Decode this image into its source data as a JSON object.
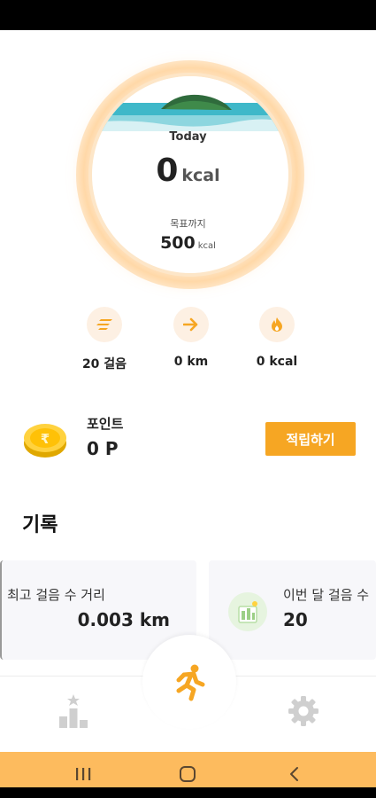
{
  "hero": {
    "today_label": "Today",
    "calories": "0",
    "calories_unit": "kcal",
    "goal_label": "목표까지",
    "goal_value": "500",
    "goal_unit": "kcal"
  },
  "stats": [
    {
      "icon": "steps-icon",
      "label": "20 걸음"
    },
    {
      "icon": "arrow-right-icon",
      "label": "0 km"
    },
    {
      "icon": "flame-icon",
      "label": "0 kcal"
    }
  ],
  "points": {
    "title": "포인트",
    "value": "0 P",
    "earn_button": "적립하기"
  },
  "records": {
    "section_title": "기록",
    "cards": [
      {
        "label": "최고 걸음 수 거리",
        "value": "0.003 km"
      },
      {
        "label": "이번 달 걸음 수",
        "value": "20"
      }
    ]
  },
  "nav": {
    "items": [
      "ranking-icon",
      "running-icon",
      "gear-icon"
    ]
  },
  "colors": {
    "accent": "#f6a623",
    "system_nav": "#fdbb5e",
    "icon_bg": "#fdf0e3"
  }
}
